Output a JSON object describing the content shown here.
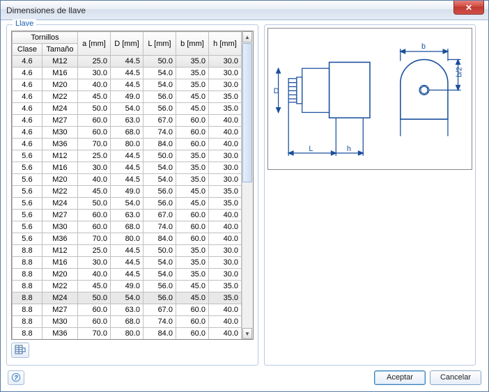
{
  "window": {
    "title": "Dimensiones de llave"
  },
  "panel": {
    "title": "Llave"
  },
  "table": {
    "group_header": "Tornillos",
    "headers": {
      "clase": "Clase",
      "tamano": "Tamaño",
      "a": "a [mm]",
      "D": "D [mm]",
      "L": "L [mm]",
      "b": "b [mm]",
      "h": "h [mm]"
    },
    "rows": [
      {
        "clase": "4.6",
        "tamano": "M12",
        "a": "25.0",
        "D": "44.5",
        "L": "50.0",
        "b": "35.0",
        "h": "30.0",
        "sel": true
      },
      {
        "clase": "4.6",
        "tamano": "M16",
        "a": "30.0",
        "D": "44.5",
        "L": "54.0",
        "b": "35.0",
        "h": "30.0"
      },
      {
        "clase": "4.6",
        "tamano": "M20",
        "a": "40.0",
        "D": "44.5",
        "L": "54.0",
        "b": "35.0",
        "h": "30.0"
      },
      {
        "clase": "4.6",
        "tamano": "M22",
        "a": "45.0",
        "D": "49.0",
        "L": "56.0",
        "b": "45.0",
        "h": "35.0"
      },
      {
        "clase": "4.6",
        "tamano": "M24",
        "a": "50.0",
        "D": "54.0",
        "L": "56.0",
        "b": "45.0",
        "h": "35.0"
      },
      {
        "clase": "4.6",
        "tamano": "M27",
        "a": "60.0",
        "D": "63.0",
        "L": "67.0",
        "b": "60.0",
        "h": "40.0"
      },
      {
        "clase": "4.6",
        "tamano": "M30",
        "a": "60.0",
        "D": "68.0",
        "L": "74.0",
        "b": "60.0",
        "h": "40.0"
      },
      {
        "clase": "4.6",
        "tamano": "M36",
        "a": "70.0",
        "D": "80.0",
        "L": "84.0",
        "b": "60.0",
        "h": "40.0"
      },
      {
        "clase": "5.6",
        "tamano": "M12",
        "a": "25.0",
        "D": "44.5",
        "L": "50.0",
        "b": "35.0",
        "h": "30.0"
      },
      {
        "clase": "5.6",
        "tamano": "M16",
        "a": "30.0",
        "D": "44.5",
        "L": "54.0",
        "b": "35.0",
        "h": "30.0"
      },
      {
        "clase": "5.6",
        "tamano": "M20",
        "a": "40.0",
        "D": "44.5",
        "L": "54.0",
        "b": "35.0",
        "h": "30.0"
      },
      {
        "clase": "5.6",
        "tamano": "M22",
        "a": "45.0",
        "D": "49.0",
        "L": "56.0",
        "b": "45.0",
        "h": "35.0"
      },
      {
        "clase": "5.6",
        "tamano": "M24",
        "a": "50.0",
        "D": "54.0",
        "L": "56.0",
        "b": "45.0",
        "h": "35.0"
      },
      {
        "clase": "5.6",
        "tamano": "M27",
        "a": "60.0",
        "D": "63.0",
        "L": "67.0",
        "b": "60.0",
        "h": "40.0"
      },
      {
        "clase": "5.6",
        "tamano": "M30",
        "a": "60.0",
        "D": "68.0",
        "L": "74.0",
        "b": "60.0",
        "h": "40.0"
      },
      {
        "clase": "5.6",
        "tamano": "M36",
        "a": "70.0",
        "D": "80.0",
        "L": "84.0",
        "b": "60.0",
        "h": "40.0"
      },
      {
        "clase": "8.8",
        "tamano": "M12",
        "a": "25.0",
        "D": "44.5",
        "L": "50.0",
        "b": "35.0",
        "h": "30.0"
      },
      {
        "clase": "8.8",
        "tamano": "M16",
        "a": "30.0",
        "D": "44.5",
        "L": "54.0",
        "b": "35.0",
        "h": "30.0"
      },
      {
        "clase": "8.8",
        "tamano": "M20",
        "a": "40.0",
        "D": "44.5",
        "L": "54.0",
        "b": "35.0",
        "h": "30.0"
      },
      {
        "clase": "8.8",
        "tamano": "M22",
        "a": "45.0",
        "D": "49.0",
        "L": "56.0",
        "b": "45.0",
        "h": "35.0"
      },
      {
        "clase": "8.8",
        "tamano": "M24",
        "a": "50.0",
        "D": "54.0",
        "L": "56.0",
        "b": "45.0",
        "h": "35.0",
        "hl": true
      },
      {
        "clase": "8.8",
        "tamano": "M27",
        "a": "60.0",
        "D": "63.0",
        "L": "67.0",
        "b": "60.0",
        "h": "40.0"
      },
      {
        "clase": "8.8",
        "tamano": "M30",
        "a": "60.0",
        "D": "68.0",
        "L": "74.0",
        "b": "60.0",
        "h": "40.0"
      },
      {
        "clase": "8.8",
        "tamano": "M36",
        "a": "70.0",
        "D": "80.0",
        "L": "84.0",
        "b": "60.0",
        "h": "40.0"
      }
    ]
  },
  "diagram": {
    "labels": {
      "D": "D",
      "L": "L",
      "h": "h",
      "b": "b",
      "b2": "b/2"
    }
  },
  "footer": {
    "accept": "Aceptar",
    "cancel": "Cancelar"
  }
}
